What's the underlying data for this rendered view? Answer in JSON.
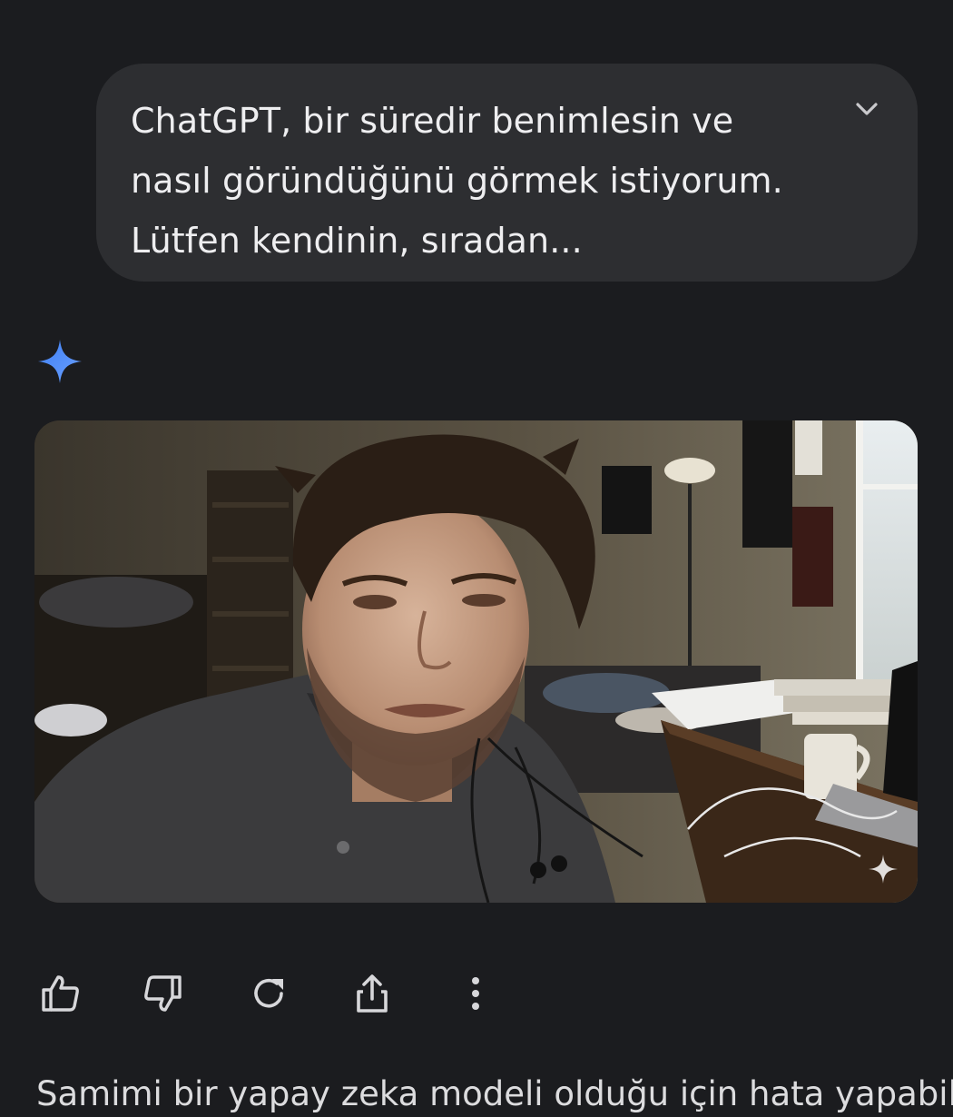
{
  "prompt": {
    "text": "ChatGPT, bir süredir benimlesin ve nasıl göründüğünü görmek istiyorum. Lütfen kendinin, sıradan...",
    "expand_icon": "chevron-down-icon"
  },
  "assistant": {
    "avatar_icon": "sparkle-icon",
    "avatar_color": "#4e86f5"
  },
  "image": {
    "subject": "photo of a tired young man with messy hair in a cluttered dim room",
    "badge_icon": "sparkle-icon"
  },
  "actions": [
    {
      "name": "like",
      "icon": "thumbs-up-icon"
    },
    {
      "name": "dislike",
      "icon": "thumbs-down-icon"
    },
    {
      "name": "regenerate",
      "icon": "refresh-icon"
    },
    {
      "name": "share",
      "icon": "share-icon"
    },
    {
      "name": "more",
      "icon": "more-vertical-icon"
    }
  ],
  "response": {
    "text": "Samimi bir yapay zeka modeli olduğu için hata yapabilir"
  }
}
